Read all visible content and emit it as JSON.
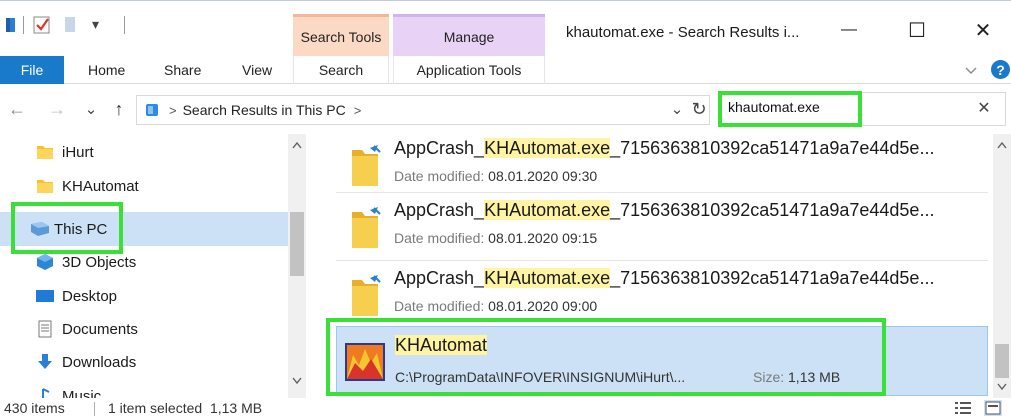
{
  "window": {
    "title": "khautomat.exe - Search Results i...",
    "minimize_glyph": "—",
    "maximize_glyph": "☐",
    "close_glyph": "✕"
  },
  "quick_access": {
    "dropdown_glyph": "▾"
  },
  "context_tabs": {
    "search_tools": "Search Tools",
    "manage": "Manage"
  },
  "ribbon": {
    "file": "File",
    "home": "Home",
    "share": "Share",
    "view": "View",
    "search": "Search",
    "application_tools": "Application Tools",
    "help": "?",
    "accent_color": "#1979ca"
  },
  "address": {
    "crumb": "Search Results in This PC",
    "sep": ">",
    "search_value": "khautomat.exe",
    "clear_glyph": "✕",
    "back_glyph": "←",
    "forward_glyph": "→",
    "recent_glyph": "⌄",
    "up_glyph": "↑",
    "dropdown_glyph": "⌄",
    "refresh_glyph": "↻"
  },
  "nav_pane": {
    "items": [
      {
        "label": "iHurt",
        "icon": "folder-icon"
      },
      {
        "label": "KHAutomat",
        "icon": "folder-icon"
      },
      {
        "label": "This PC",
        "icon": "this-pc-icon",
        "selected": true
      },
      {
        "label": "3D Objects",
        "icon": "3d-objects-icon"
      },
      {
        "label": "Desktop",
        "icon": "desktop-icon"
      },
      {
        "label": "Documents",
        "icon": "documents-icon"
      },
      {
        "label": "Downloads",
        "icon": "downloads-icon"
      },
      {
        "label": "Music",
        "icon": "music-icon"
      }
    ]
  },
  "results": {
    "date_label": "Date modified:",
    "size_label": "Size:",
    "items": [
      {
        "prefix": "AppCrash_",
        "highlight": "KHAutomat.exe",
        "suffix": "_7156363810392ca51471a9a7e44d5e...",
        "date": "08.01.2020 09:30",
        "icon": "folder-icon"
      },
      {
        "prefix": "AppCrash_",
        "highlight": "KHAutomat.exe",
        "suffix": "_7156363810392ca51471a9a7e44d5e...",
        "date": "08.01.2020 09:15",
        "icon": "folder-icon"
      },
      {
        "prefix": "AppCrash_",
        "highlight": "KHAutomat.exe",
        "suffix": "_7156363810392ca51471a9a7e44d5e...",
        "date": "08.01.2020 09:00",
        "icon": "folder-icon"
      },
      {
        "name": "KHAutomat",
        "path": "C:\\ProgramData\\INFOVER\\INSIGNUM\\iHurt\\...",
        "size": "1,13 MB",
        "icon": "application-icon",
        "selected": true
      }
    ]
  },
  "status": {
    "item_count": "430 items",
    "selection": "1 item selected  1,13 MB"
  },
  "colors": {
    "selection_bg": "#cce1f5",
    "highlight_green": "#38e038",
    "search_tools_tab": "#fcd9c4",
    "manage_tab": "#e8d2f5",
    "match_highlight": "#fff3a4"
  }
}
